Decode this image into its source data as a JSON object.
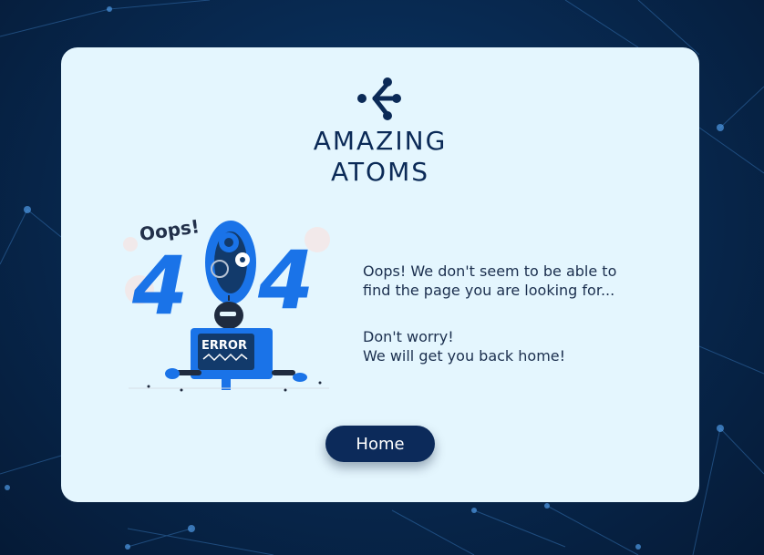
{
  "brand": {
    "name_line1": "AMAZING",
    "name_line2": "ATOMS",
    "color": "#0b2a57"
  },
  "illustration": {
    "oops_text": "Oops!",
    "code_digit1": "4",
    "code_digit2": "4",
    "screen_text": "ERROR",
    "accent_color": "#1a73e8"
  },
  "message": {
    "line1": "Oops! We don't seem to be able to",
    "line2": "find the page you are looking for...",
    "line3": "Don't worry!",
    "line4": "We will get you back home!"
  },
  "home_button": {
    "label": "Home",
    "color": "#0c2a5a"
  },
  "colors": {
    "background": "#082a52",
    "card": "#e4f6fe",
    "text": "#1b2f4e"
  }
}
